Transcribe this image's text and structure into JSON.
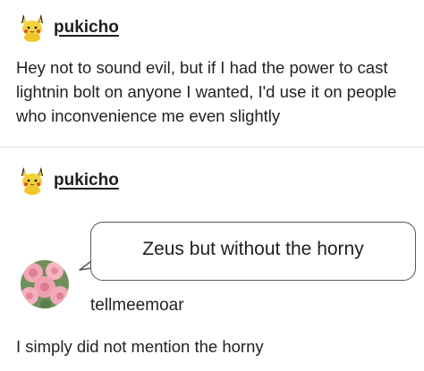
{
  "post1": {
    "avatar_icon": "pikachu-avatar-icon",
    "username": "pukicho",
    "text": "Hey not to sound evil, but if I had the power to cast lightnin bolt on anyone I wanted, I'd use it on people who inconvenience me even slightly"
  },
  "post2": {
    "avatar_icon": "pikachu-avatar-icon",
    "username": "pukicho",
    "bubble_text": "Zeus but without the horny"
  },
  "reply": {
    "avatar_icon": "roses-avatar-icon",
    "username": "tellmeemoar",
    "text": "I simply did not mention the horny"
  },
  "colors": {
    "text": "#222222",
    "divider": "#d8d8d8",
    "bubble_border": "#555555"
  }
}
